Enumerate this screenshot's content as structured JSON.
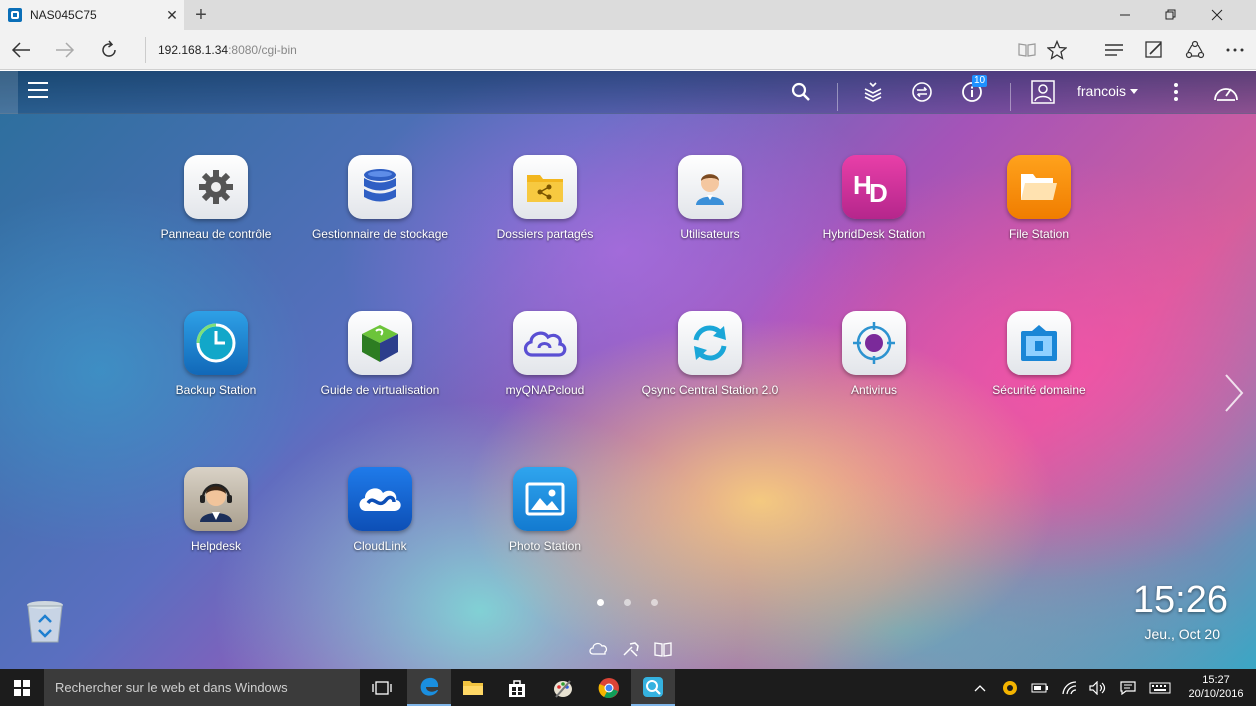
{
  "browser": {
    "tab_title": "NAS045C75",
    "tab_close": "✕",
    "new_tab": "+",
    "url_host": "192.168.1.34",
    "url_rest": ":8080/cgi-bin"
  },
  "qts": {
    "user": "francois",
    "notification_count": "10",
    "apps": [
      {
        "label": "Panneau de contrôle",
        "icon": "gear-icon"
      },
      {
        "label": "Gestionnaire de stockage",
        "icon": "database-icon"
      },
      {
        "label": "Dossiers partagés",
        "icon": "shared-folder-icon"
      },
      {
        "label": "Utilisateurs",
        "icon": "user-icon"
      },
      {
        "label": "HybridDesk Station",
        "icon": "hd-icon"
      },
      {
        "label": "File Station",
        "icon": "folder-icon"
      },
      {
        "label": "Backup Station",
        "icon": "clock-icon"
      },
      {
        "label": "Guide de virtualisation",
        "icon": "cube-icon"
      },
      {
        "label": "myQNAPcloud",
        "icon": "cloud-icon"
      },
      {
        "label": "Qsync Central Station 2.0",
        "icon": "sync-icon"
      },
      {
        "label": "Antivirus",
        "icon": "virus-target-icon"
      },
      {
        "label": "Sécurité domaine",
        "icon": "domain-security-icon"
      },
      {
        "label": "Helpdesk",
        "icon": "headset-agent-icon"
      },
      {
        "label": "CloudLink",
        "icon": "cloudlink-icon"
      },
      {
        "label": "Photo Station",
        "icon": "photo-icon"
      }
    ],
    "clock_time": "15:26",
    "clock_date": "Jeu., Oct 20"
  },
  "taskbar": {
    "search_placeholder": "Rechercher sur le web et dans Windows",
    "time": "15:27",
    "date": "20/10/2016"
  },
  "colors": {
    "accent": "#1e90ff",
    "taskbar_bg": "#1c1c1c"
  }
}
